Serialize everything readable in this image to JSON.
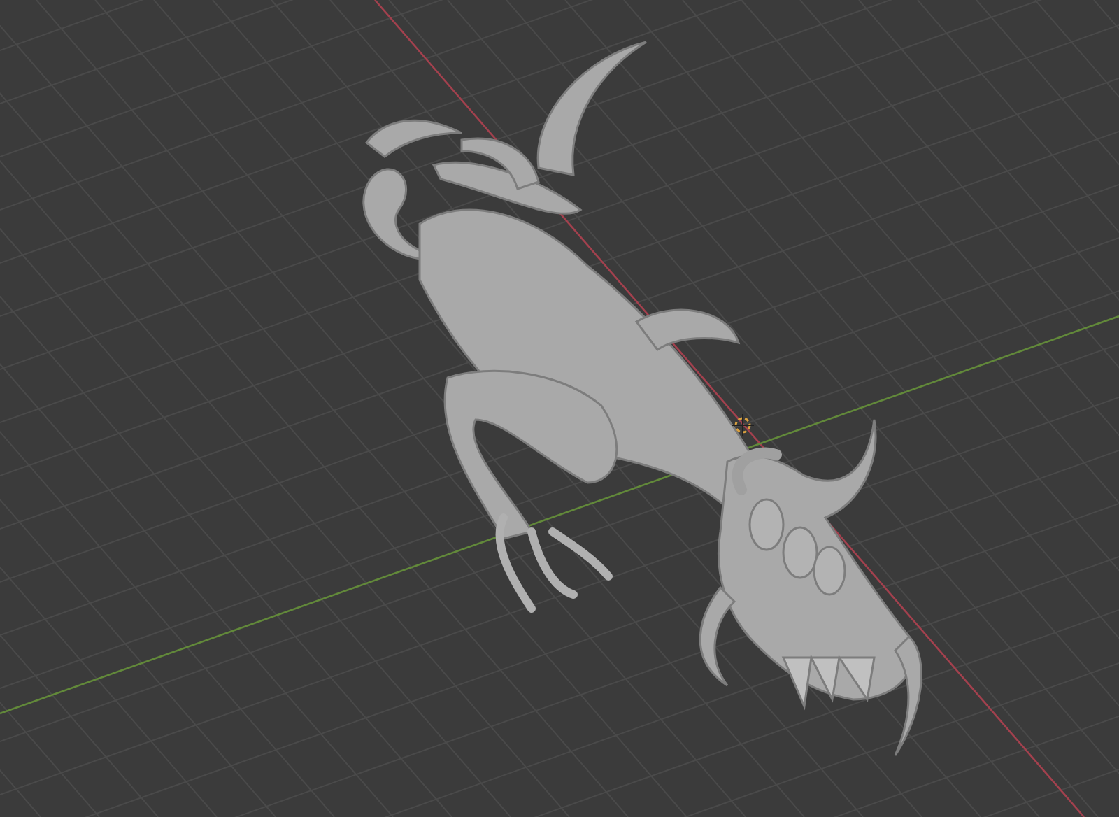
{
  "viewport": {
    "axes": [
      {
        "kind": "x",
        "color": "#a3414e"
      },
      {
        "kind": "y",
        "color": "#62893a"
      }
    ],
    "cursor_3d": true,
    "model": {
      "kind": "creature"
    }
  }
}
